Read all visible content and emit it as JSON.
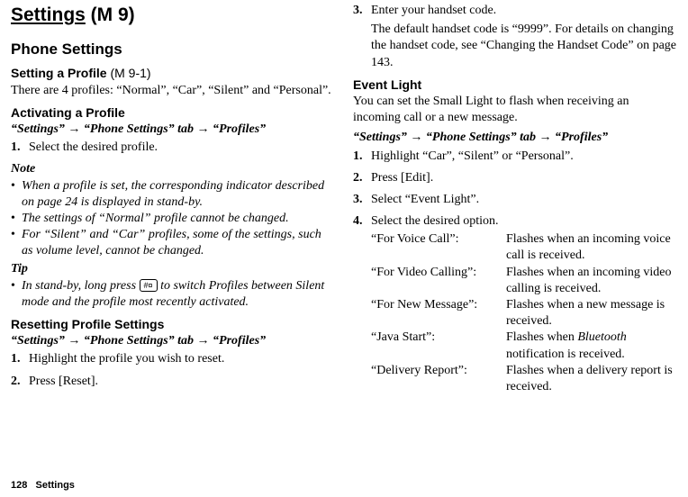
{
  "h1_main": "Settings",
  "h1_code": " (M 9)",
  "h2_phone": "Phone Settings",
  "h3_setprofile": "Setting a Profile",
  "h3_setprofile_code": " (M 9-1)",
  "profiles_intro": "There are 4 profiles: “Normal”, “Car”, “Silent” and “Personal”.",
  "h3_activating": "Activating a Profile",
  "nav1_a": "“Settings” ",
  "nav1_b": " “Phone Settings” tab ",
  "nav1_c": " “Profiles”",
  "arrow": "→",
  "step_sel_profile_num": "1.",
  "step_sel_profile": "Select the desired profile.",
  "note_head": "Note",
  "note1": "When a profile is set, the corresponding indicator described on page 24 is displayed in stand-by.",
  "note2": "The settings of “Normal” profile cannot be changed.",
  "note3": "For “Silent” and “Car” profiles, some of the settings, such as volume level, cannot be changed.",
  "tip_head": "Tip",
  "tip1_a": "In stand-by, long press ",
  "tip1_key": "#¤",
  "tip1_b": " to switch Profiles between Silent mode and the profile most recently activated.",
  "h3_reset": "Resetting Profile Settings",
  "reset1_num": "1.",
  "reset1": "Highlight the profile you wish to reset.",
  "reset2_num": "2.",
  "reset2": "Press [Reset].",
  "reset3_num": "3.",
  "reset3": "Enter your handset code.",
  "reset3_sub": "The default handset code is “9999”. For details on changing the handset code, see “Changing the Handset Code” on page 143.",
  "h3_event": "Event Light",
  "event_intro": "You can set the Small Light to flash when receiving an incoming call or a new message.",
  "ev1_num": "1.",
  "ev1": "Highlight “Car”, “Silent” or “Personal”.",
  "ev2_num": "2.",
  "ev2": "Press [Edit].",
  "ev3_num": "3.",
  "ev3": "Select “Event Light”.",
  "ev4_num": "4.",
  "ev4": "Select the desired option.",
  "def1t": "“For Voice Call”:",
  "def1d": "Flashes when an incoming voice call is received.",
  "def2t": "“For Video Calling”:",
  "def2d": "Flashes when an incoming video calling is received.",
  "def3t": "“For New Message”:",
  "def3d": "Flashes when a new message is received.",
  "def4t": "“Java Start”:",
  "def4d_a": "Flashes when ",
  "def4d_i": "Bluetooth",
  "def4d_b": " notification is received.",
  "def5t": "“Delivery Report”:",
  "def5d": "Flashes when a delivery report is received.",
  "footer_num": "128",
  "footer_text": "Settings",
  "bullet_char": "•"
}
